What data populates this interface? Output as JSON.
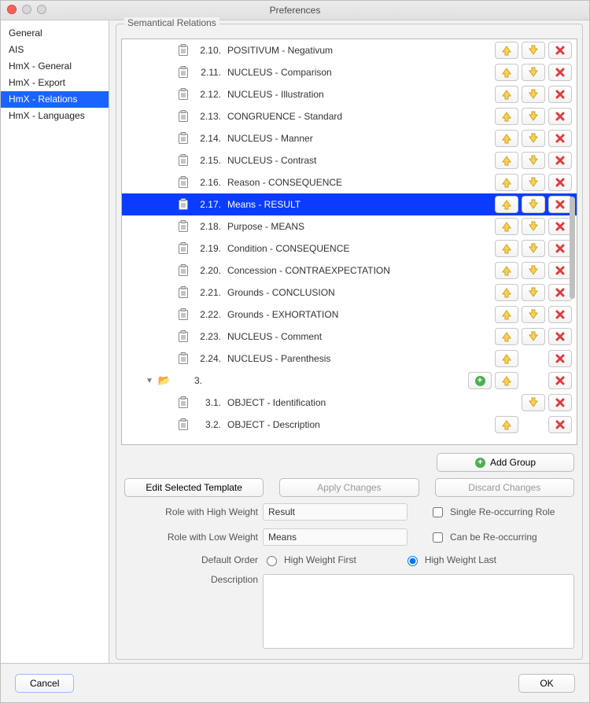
{
  "title": "Preferences",
  "sidebar": {
    "items": [
      {
        "label": "General"
      },
      {
        "label": "AIS"
      },
      {
        "label": "HmX - General"
      },
      {
        "label": "HmX - Export"
      },
      {
        "label": "HmX - Relations",
        "selected": true
      },
      {
        "label": "HmX - Languages"
      }
    ]
  },
  "fieldset_title": "Semantical Relations",
  "rows": [
    {
      "type": "item",
      "depth": 2,
      "num": "2.10.",
      "label": "POSITIVUM - Negativum",
      "up": true,
      "down": true,
      "del": true
    },
    {
      "type": "item",
      "depth": 2,
      "num": "2.11.",
      "label": "NUCLEUS - Comparison",
      "up": true,
      "down": true,
      "del": true
    },
    {
      "type": "item",
      "depth": 2,
      "num": "2.12.",
      "label": "NUCLEUS - Illustration",
      "up": true,
      "down": true,
      "del": true
    },
    {
      "type": "item",
      "depth": 2,
      "num": "2.13.",
      "label": "CONGRUENCE - Standard",
      "up": true,
      "down": true,
      "del": true
    },
    {
      "type": "item",
      "depth": 2,
      "num": "2.14.",
      "label": "NUCLEUS - Manner",
      "up": true,
      "down": true,
      "del": true
    },
    {
      "type": "item",
      "depth": 2,
      "num": "2.15.",
      "label": "NUCLEUS - Contrast",
      "up": true,
      "down": true,
      "del": true
    },
    {
      "type": "item",
      "depth": 2,
      "num": "2.16.",
      "label": "Reason - CONSEQUENCE",
      "up": true,
      "down": true,
      "del": true
    },
    {
      "type": "item",
      "depth": 2,
      "num": "2.17.",
      "label": "Means - RESULT",
      "up": true,
      "down": true,
      "del": true,
      "selected": true
    },
    {
      "type": "item",
      "depth": 2,
      "num": "2.18.",
      "label": "Purpose - MEANS",
      "up": true,
      "down": true,
      "del": true
    },
    {
      "type": "item",
      "depth": 2,
      "num": "2.19.",
      "label": "Condition - CONSEQUENCE",
      "up": true,
      "down": true,
      "del": true
    },
    {
      "type": "item",
      "depth": 2,
      "num": "2.20.",
      "label": "Concession - CONTRAEXPECTATION",
      "up": true,
      "down": true,
      "del": true
    },
    {
      "type": "item",
      "depth": 2,
      "num": "2.21.",
      "label": "Grounds - CONCLUSION",
      "up": true,
      "down": true,
      "del": true
    },
    {
      "type": "item",
      "depth": 2,
      "num": "2.22.",
      "label": "Grounds - EXHORTATION",
      "up": true,
      "down": true,
      "del": true
    },
    {
      "type": "item",
      "depth": 2,
      "num": "2.23.",
      "label": "NUCLEUS - Comment",
      "up": true,
      "down": true,
      "del": true
    },
    {
      "type": "item",
      "depth": 2,
      "num": "2.24.",
      "label": "NUCLEUS - Parenthesis",
      "up": true,
      "down": false,
      "del": true
    },
    {
      "type": "group",
      "depth": 1,
      "num": "3.",
      "label": "",
      "add": true,
      "up": true,
      "down": false,
      "del": true
    },
    {
      "type": "item",
      "depth": 2,
      "num": "3.1.",
      "label": "OBJECT - Identification",
      "up": false,
      "down": true,
      "del": true
    },
    {
      "type": "item",
      "depth": 2,
      "num": "3.2.",
      "label": "OBJECT - Description",
      "up": true,
      "down": false,
      "del": true
    }
  ],
  "add_group_label": "Add Group",
  "buttons": {
    "edit": "Edit Selected Template",
    "apply": "Apply Changes",
    "discard": "Discard Changes"
  },
  "form": {
    "role_high_label": "Role with High Weight",
    "role_high_value": "Result",
    "role_low_label": "Role with Low Weight",
    "role_low_value": "Means",
    "single_recur": "Single Re-occurring Role",
    "can_recur": "Can be Re-occurring",
    "default_order": "Default Order",
    "high_first": "High Weight First",
    "high_last": "High Weight Last",
    "description_label": "Description",
    "description_value": ""
  },
  "footer": {
    "cancel": "Cancel",
    "ok": "OK"
  }
}
